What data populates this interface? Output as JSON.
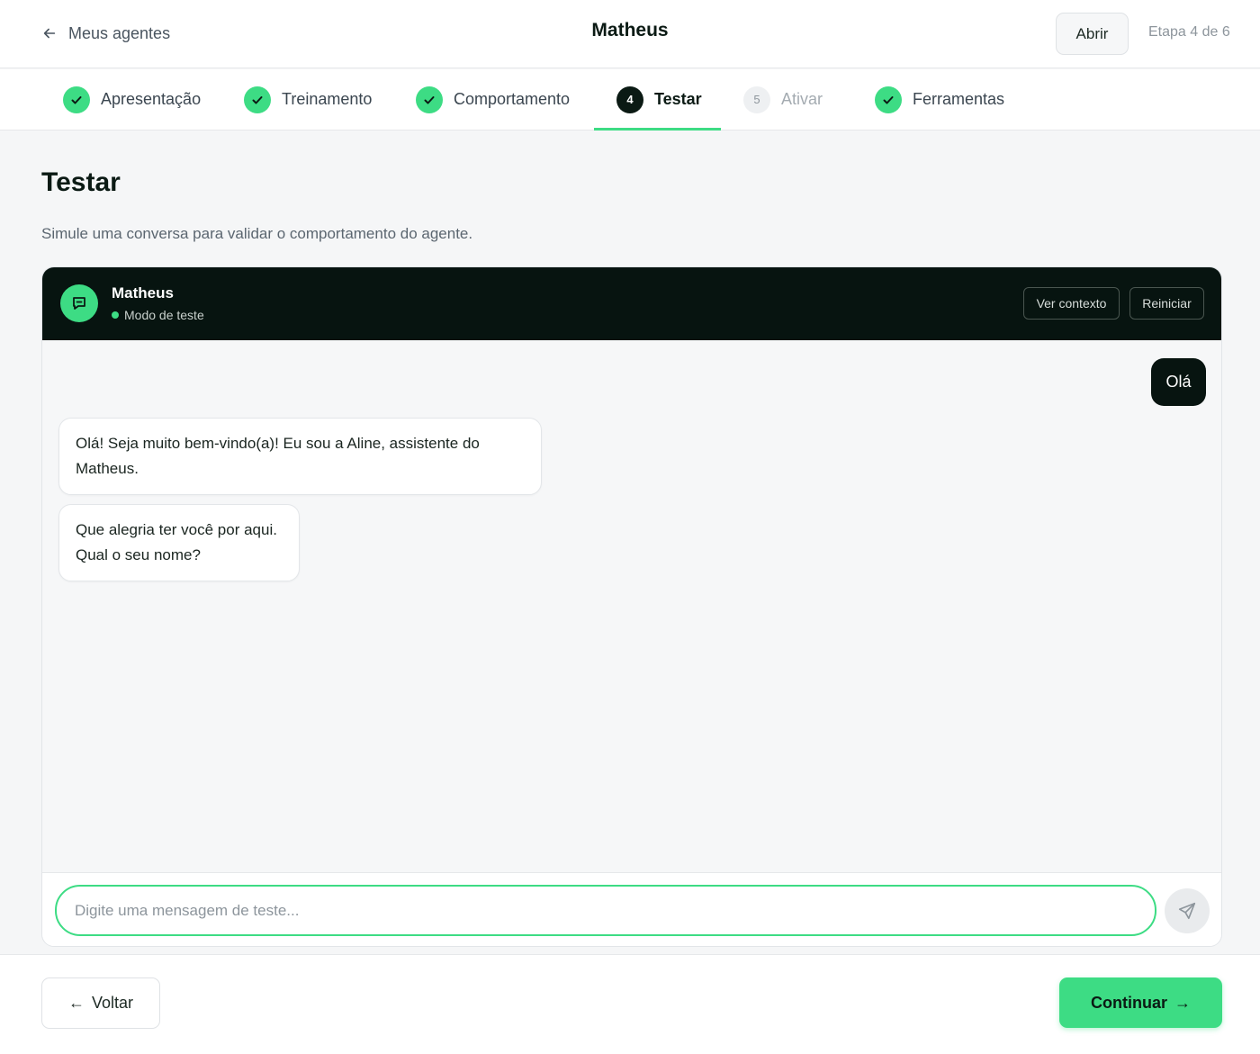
{
  "topbar": {
    "back_label": "Meus agentes",
    "title": "Matheus",
    "open_label": "Abrir",
    "step_counter": "Etapa 4 de 6"
  },
  "steps": [
    {
      "label": "Apresentação",
      "state": "done"
    },
    {
      "label": "Treinamento",
      "state": "done"
    },
    {
      "label": "Comportamento",
      "state": "done"
    },
    {
      "label": "Testar",
      "number": "4",
      "state": "current"
    },
    {
      "label": "Ativar",
      "number": "5",
      "state": "pending"
    },
    {
      "label": "Ferramentas",
      "state": "done"
    }
  ],
  "page": {
    "heading": "Testar",
    "subtitle": "Simule uma conversa para validar o comportamento do agente."
  },
  "chat": {
    "agent_name": "Matheus",
    "status": "Modo de teste",
    "context_label": "Ver contexto",
    "restart_label": "Reiniciar",
    "messages": [
      {
        "from": "user",
        "text": "Olá"
      },
      {
        "from": "agent",
        "text": "Olá! Seja muito bem-vindo(a)! Eu sou a Aline, assistente do Matheus."
      },
      {
        "from": "agent",
        "text": "Que alegria ter você por aqui. Qual o seu nome?"
      }
    ],
    "input_placeholder": "Digite uma mensagem de teste..."
  },
  "footer": {
    "back_label": "Voltar",
    "continue_label": "Continuar"
  },
  "icons": {
    "back": "arrow-left-icon",
    "done": "check-icon",
    "avatar": "chat-bubble-icon",
    "send": "send-icon"
  },
  "colors": {
    "accent": "#3ddc84",
    "dark": "#071410",
    "background": "#f5f6f7"
  }
}
